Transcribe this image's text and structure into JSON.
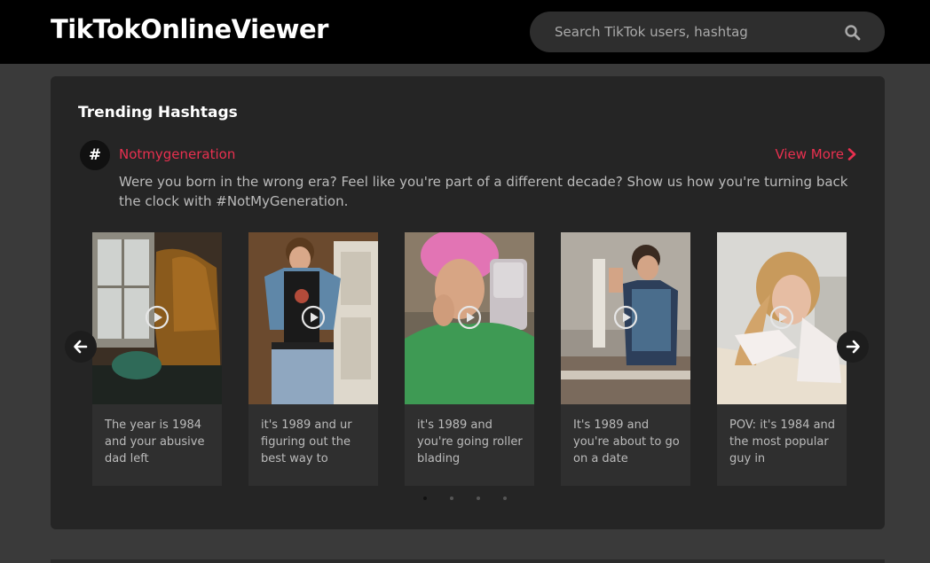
{
  "header": {
    "logo": "TikTokOnlineViewer",
    "search_placeholder": "Search TikTok users, hashtag",
    "search_icon": "search-icon"
  },
  "trending": {
    "title": "Trending Hashtags",
    "hashtag_symbol": "#",
    "hashtag_name": "Notmygeneration",
    "view_more": "View More",
    "description": "Were you born in the wrong era? Feel like you're part of a different decade? Show us how you're turning back the clock with #NotMyGeneration.",
    "videos": [
      {
        "caption": "The year is 1984 and your abusive dad left"
      },
      {
        "caption": "it's 1989 and ur figuring out the best way to"
      },
      {
        "caption": "it's 1989 and you're going roller blading"
      },
      {
        "caption": "It's 1989 and you're about to go on a date"
      },
      {
        "caption": "POV: it's 1984 and the most popular guy in"
      }
    ],
    "pagination": {
      "pages": 4,
      "current": 1
    }
  },
  "colors": {
    "accent": "#e8304f",
    "background": "#3a3a3a",
    "panel": "#252525",
    "topbar": "#000000"
  }
}
